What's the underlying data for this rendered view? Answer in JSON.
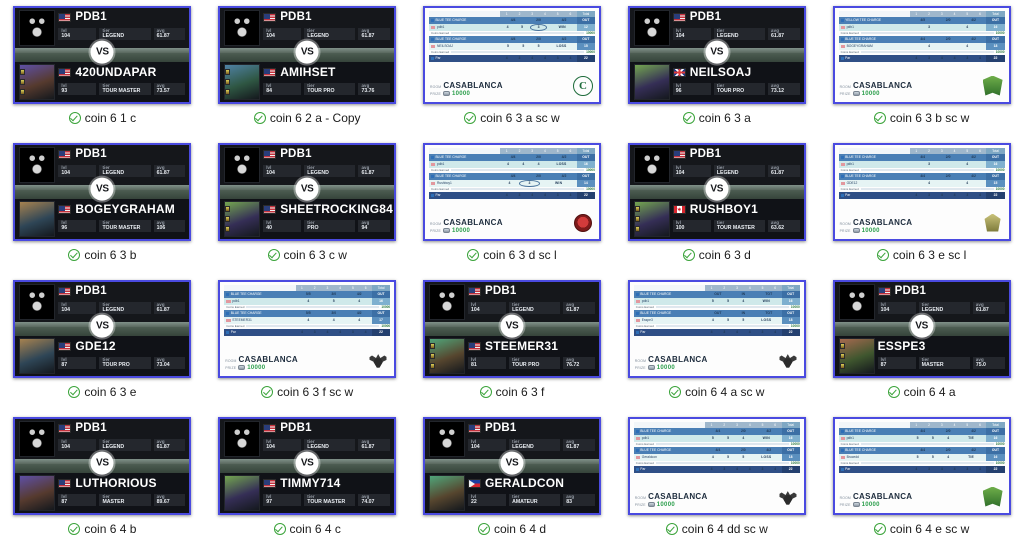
{
  "gallery": {
    "columns": 5,
    "rows": 4,
    "check_color": "#3aa33a",
    "thumb_border_color": "#4a4ae0"
  },
  "vs_label": "VS",
  "hero": {
    "name": "PDB1",
    "flag": "us",
    "lvl_label": "lvl",
    "tier_label": "tier",
    "avg_label": "avg",
    "lvl": "104",
    "tier": "LEGEND",
    "avg": "61.87"
  },
  "scorecard_labels": {
    "room_key": "ROOM",
    "prize_key": "PRIZE",
    "coins_key": "Coins Earned",
    "room": "CASABLANCA",
    "prize": "10000",
    "par_label": "Par",
    "total_label": "Total"
  },
  "items": [
    {
      "type": "vs",
      "caption": "coin 6 1 c",
      "opponent": {
        "name": "420UNDAPAR",
        "flag": "us",
        "lvl": "93",
        "tier": "TOUR MASTER",
        "avg": "73.57",
        "avatar": "golfer-red-cap",
        "medals": true
      }
    },
    {
      "type": "vs",
      "caption": "coin 6 2 a - Copy",
      "opponent": {
        "name": "AMIHSET",
        "flag": "us",
        "lvl": "84",
        "tier": "TOUR PRO",
        "avg": "73.76",
        "avatar": "house-photo",
        "medals": true
      }
    },
    {
      "type": "scorecard",
      "caption": "coin 6 3 a sc w",
      "logo": "monogram-c",
      "holes": [
        "1",
        "2",
        "3",
        "4",
        "5",
        "6"
      ],
      "rows": [
        {
          "style": "blue",
          "label": "BLUE TEE CHARGE",
          "cells": [
            "4/4",
            "2/0",
            "4/2"
          ],
          "total": "OUT"
        },
        {
          "style": "teal",
          "label": "pdb1",
          "cells": [
            "4",
            "5|box",
            "3|circ",
            "WIN|res"
          ],
          "total": "12"
        },
        {
          "style": "blue",
          "label": "BLUE TEE CHARGE",
          "cells": [
            "4/4",
            "2/0",
            "4/2"
          ],
          "total": "OUT"
        },
        {
          "style": "lightteal",
          "label": "NEILSOAJ",
          "cells": [
            "5|box",
            "5|box",
            "5|box",
            "LOSS|res"
          ],
          "total": "15"
        },
        {
          "style": "navy",
          "label": "Par",
          "cells": [
            "4",
            "3",
            "4",
            "4",
            "3",
            "4"
          ],
          "total": "22"
        }
      ]
    },
    {
      "type": "vs",
      "caption": "coin 6 3 a",
      "opponent": {
        "name": "NEILSOAJ",
        "flag": "uk",
        "lvl": "96",
        "tier": "TOUR PRO",
        "avg": "73.12",
        "avatar": "golfer-blue-cap",
        "medals": false
      }
    },
    {
      "type": "scorecard",
      "caption": "coin 6 3 b sc w",
      "logo": "crest-green",
      "holes": [
        "1",
        "2",
        "3",
        "4",
        "5",
        "6"
      ],
      "rows": [
        {
          "style": "blue",
          "label": "YELLOW TEE CHARGE",
          "cells": [
            "4/5",
            "2/0",
            "4/2"
          ],
          "total": "OUT"
        },
        {
          "style": "teal",
          "label": "pdb1",
          "cells": [
            "3|box",
            "4"
          ],
          "total": "16"
        },
        {
          "style": "blue",
          "label": "BLUE TEE CHARGE",
          "cells": [
            "4/4",
            "2/0",
            "4/2"
          ],
          "total": "OUT"
        },
        {
          "style": "lightteal",
          "label": "BOGEYGRAHAM",
          "cells": [
            "4",
            "4"
          ],
          "total": "18"
        },
        {
          "style": "navy",
          "label": "Par",
          "cells": [
            "4",
            "3",
            "4",
            "4",
            "3",
            "4"
          ],
          "total": "22"
        }
      ]
    },
    {
      "type": "vs",
      "caption": "coin 6 3 b",
      "opponent": {
        "name": "BOGEYGRAHAM",
        "flag": "us",
        "lvl": "96",
        "tier": "TOUR MASTER",
        "avg": "106",
        "avatar": "vintage-portrait",
        "medals": false
      }
    },
    {
      "type": "vs",
      "caption": "coin 6 3 c w",
      "opponent": {
        "name": "SHEETROCKING84",
        "flag": "us",
        "lvl": "40",
        "tier": "PRO",
        "avg": "94",
        "avatar": "golfer-striped",
        "medals": true
      }
    },
    {
      "type": "scorecard",
      "caption": "coin 6 3 d sc l",
      "logo": "red-seal",
      "holes": [
        "1",
        "2",
        "3",
        "4",
        "5",
        "6"
      ],
      "rows": [
        {
          "style": "blue",
          "label": "BLUE TEE CHARGE",
          "cells": [
            "4/4",
            "2/0",
            "4/2"
          ],
          "total": "OUT"
        },
        {
          "style": "teal",
          "label": "pdb1",
          "cells": [
            "4",
            "4",
            "4",
            "LOSS|res"
          ],
          "total": "16"
        },
        {
          "style": "blue",
          "label": "BLUE TEE CHARGE",
          "cells": [
            "4/4",
            "2/0",
            "4/2"
          ],
          "total": "OUT"
        },
        {
          "style": "lightteal",
          "label": "Rushboy1",
          "cells": [
            "4",
            "3|circ",
            "WIN|res"
          ],
          "total": "14"
        },
        {
          "style": "navy",
          "label": "Par",
          "cells": [
            "4",
            "3",
            "4",
            "4",
            "3",
            "4"
          ],
          "total": "22"
        }
      ]
    },
    {
      "type": "vs",
      "caption": "coin 6 3 d",
      "opponent": {
        "name": "RUSHBOY1",
        "flag": "ca",
        "lvl": "100",
        "tier": "TOUR MASTER",
        "avg": "63.62",
        "avatar": "golfer-navy-cap",
        "medals": true
      }
    },
    {
      "type": "scorecard",
      "caption": "coin 6 3 e sc l",
      "logo": "olive-crest",
      "holes": [
        "1",
        "2",
        "3",
        "4",
        "5",
        "6"
      ],
      "rows": [
        {
          "style": "blue",
          "label": "BLUE TEE CHARGE",
          "cells": [
            "4/4",
            "2/0",
            "4/2"
          ],
          "total": "OUT"
        },
        {
          "style": "teal",
          "label": "pdb1",
          "cells": [
            "3|box",
            "4"
          ],
          "total": "16"
        },
        {
          "style": "blue",
          "label": "BLUE TEE CHARGE",
          "cells": [
            "4/4",
            "2/0",
            "4/2"
          ],
          "total": "OUT"
        },
        {
          "style": "lightteal",
          "label": "GDE12",
          "cells": [
            "4",
            "4"
          ],
          "total": "15"
        },
        {
          "style": "navy",
          "label": "Par",
          "cells": [
            "4",
            "3",
            "4",
            "4",
            "3",
            "4"
          ],
          "total": "22"
        }
      ]
    },
    {
      "type": "vs",
      "caption": "coin 6 3 e",
      "opponent": {
        "name": "GDE12",
        "flag": "us",
        "lvl": "87",
        "tier": "TOUR PRO",
        "avg": "73.04",
        "avatar": "golfer-white-cap",
        "medals": false
      }
    },
    {
      "type": "scorecard",
      "caption": "coin 6 3 f sc w",
      "logo": "eagle-wings",
      "holes": [
        "1",
        "2",
        "3",
        "4",
        "5",
        "6"
      ],
      "rows": [
        {
          "style": "blue",
          "label": "BLUE TEE CHARGE",
          "cells": [
            "5/5",
            "3/0",
            "4/2"
          ],
          "total": "OUT"
        },
        {
          "style": "teal",
          "label": "pdb1",
          "cells": [
            "4",
            "5|box",
            "4"
          ],
          "total": "16"
        },
        {
          "style": "blue",
          "label": "BLUE TEE CHARGE",
          "cells": [
            "5/5",
            "3/0",
            "4/2"
          ],
          "total": "OUT"
        },
        {
          "style": "lightteal",
          "label": "STEEMER31",
          "cells": [
            "4",
            "4|box",
            "4"
          ],
          "total": "17"
        },
        {
          "style": "navy",
          "label": "Par",
          "cells": [
            "4",
            "3",
            "4",
            "4",
            "3",
            "4"
          ],
          "total": "22"
        }
      ]
    },
    {
      "type": "vs",
      "caption": "coin 6 3 f",
      "opponent": {
        "name": "STEEMER31",
        "flag": "us",
        "lvl": "81",
        "tier": "TOUR PRO",
        "avg": "76.72",
        "avatar": "golfer-purple-cap",
        "medals": true
      }
    },
    {
      "type": "scorecard",
      "caption": "coin 6 4 a sc w",
      "logo": "eagle-wings",
      "holes": [
        "1",
        "2",
        "3",
        "4",
        "5",
        "6"
      ],
      "rows": [
        {
          "style": "blue",
          "label": "BLUE TEE CHARGE",
          "cells": [
            "OUT",
            "IN",
            "TOT"
          ],
          "total": "OUT"
        },
        {
          "style": "teal",
          "label": "pdb1",
          "cells": [
            "5|box",
            "5",
            "4",
            "WIN|res"
          ],
          "total": "16"
        },
        {
          "style": "blue",
          "label": "BLUE TEE CHARGE",
          "cells": [
            "OUT",
            "IN",
            "TOT"
          ],
          "total": "OUT"
        },
        {
          "style": "lightteal",
          "label": "Esspe3",
          "cells": [
            "4",
            "5",
            "5",
            "LOSS|res"
          ],
          "total": "18"
        },
        {
          "style": "navy",
          "label": "Par",
          "cells": [
            "4",
            "3",
            "4",
            "4",
            "3",
            "4"
          ],
          "total": "22"
        }
      ]
    },
    {
      "type": "vs",
      "caption": "coin 6 4 a",
      "opponent": {
        "name": "ESSPE3",
        "flag": "none",
        "lvl": "87",
        "tier": "MASTER",
        "avg": "75.0",
        "avatar": "man-beach",
        "medals": true
      }
    },
    {
      "type": "vs",
      "caption": "coin 6 4 b",
      "opponent": {
        "name": "LUTHORIOUS",
        "flag": "us",
        "lvl": "87",
        "tier": "MASTER",
        "avg": "89.67",
        "avatar": "man-green-shirt",
        "medals": false
      }
    },
    {
      "type": "vs",
      "caption": "coin 6 4 c",
      "opponent": {
        "name": "TIMMY714",
        "flag": "us",
        "lvl": "97",
        "tier": "TOUR MASTER",
        "avg": "74.07",
        "avatar": "man-sunglasses",
        "medals": false
      }
    },
    {
      "type": "vs",
      "caption": "coin 6 4 d",
      "opponent": {
        "name": "GERALDCON",
        "flag": "ph",
        "lvl": "22",
        "tier": "AMATEUR",
        "avg": "83",
        "avatar": "golfer-red-cap2",
        "medals": false
      }
    },
    {
      "type": "scorecard",
      "caption": "coin 6 4 dd sc w",
      "logo": "eagle-wings",
      "holes": [
        "1",
        "2",
        "3",
        "4",
        "5",
        "6"
      ],
      "rows": [
        {
          "style": "blue",
          "label": "BLUE TEE CHARGE",
          "cells": [
            "4/4",
            "2/0",
            "4/2"
          ],
          "total": "OUT"
        },
        {
          "style": "teal",
          "label": "pdb1",
          "cells": [
            "5|box",
            "5",
            "4",
            "WIN|res"
          ],
          "total": "16"
        },
        {
          "style": "blue",
          "label": "BLUE TEE CHARGE",
          "cells": [
            "4/4",
            "2/0",
            "4/2"
          ],
          "total": "OUT"
        },
        {
          "style": "lightteal",
          "label": "Geraldcon",
          "cells": [
            "4",
            "5",
            "5",
            "LOSS|res"
          ],
          "total": "18"
        },
        {
          "style": "navy",
          "label": "Par",
          "cells": [
            "4",
            "3",
            "4",
            "4",
            "3",
            "4"
          ],
          "total": "22"
        }
      ]
    },
    {
      "type": "scorecard",
      "caption": "coin 6 4 e sc w",
      "logo": "crest-green",
      "holes": [
        "1",
        "2",
        "3",
        "4",
        "5",
        "6"
      ],
      "rows": [
        {
          "style": "blue",
          "label": "BLUE TEE CHARGE",
          "cells": [
            "4/4",
            "2/0",
            "4/2"
          ],
          "total": "OUT"
        },
        {
          "style": "teal",
          "label": "pdb1",
          "cells": [
            "5|box",
            "5",
            "4",
            "TIE|res"
          ],
          "total": "16"
        },
        {
          "style": "blue",
          "label": "BLUE TEE CHARGE",
          "cells": [
            "4/4",
            "2/0",
            "4/2"
          ],
          "total": "OUT"
        },
        {
          "style": "lightteal",
          "label": "Brucedd",
          "cells": [
            "5|box",
            "5",
            "4",
            "TIE|res"
          ],
          "total": "16"
        },
        {
          "style": "navy",
          "label": "Par",
          "cells": [
            "4",
            "3",
            "4",
            "4",
            "3",
            "4"
          ],
          "total": "22"
        }
      ]
    }
  ]
}
